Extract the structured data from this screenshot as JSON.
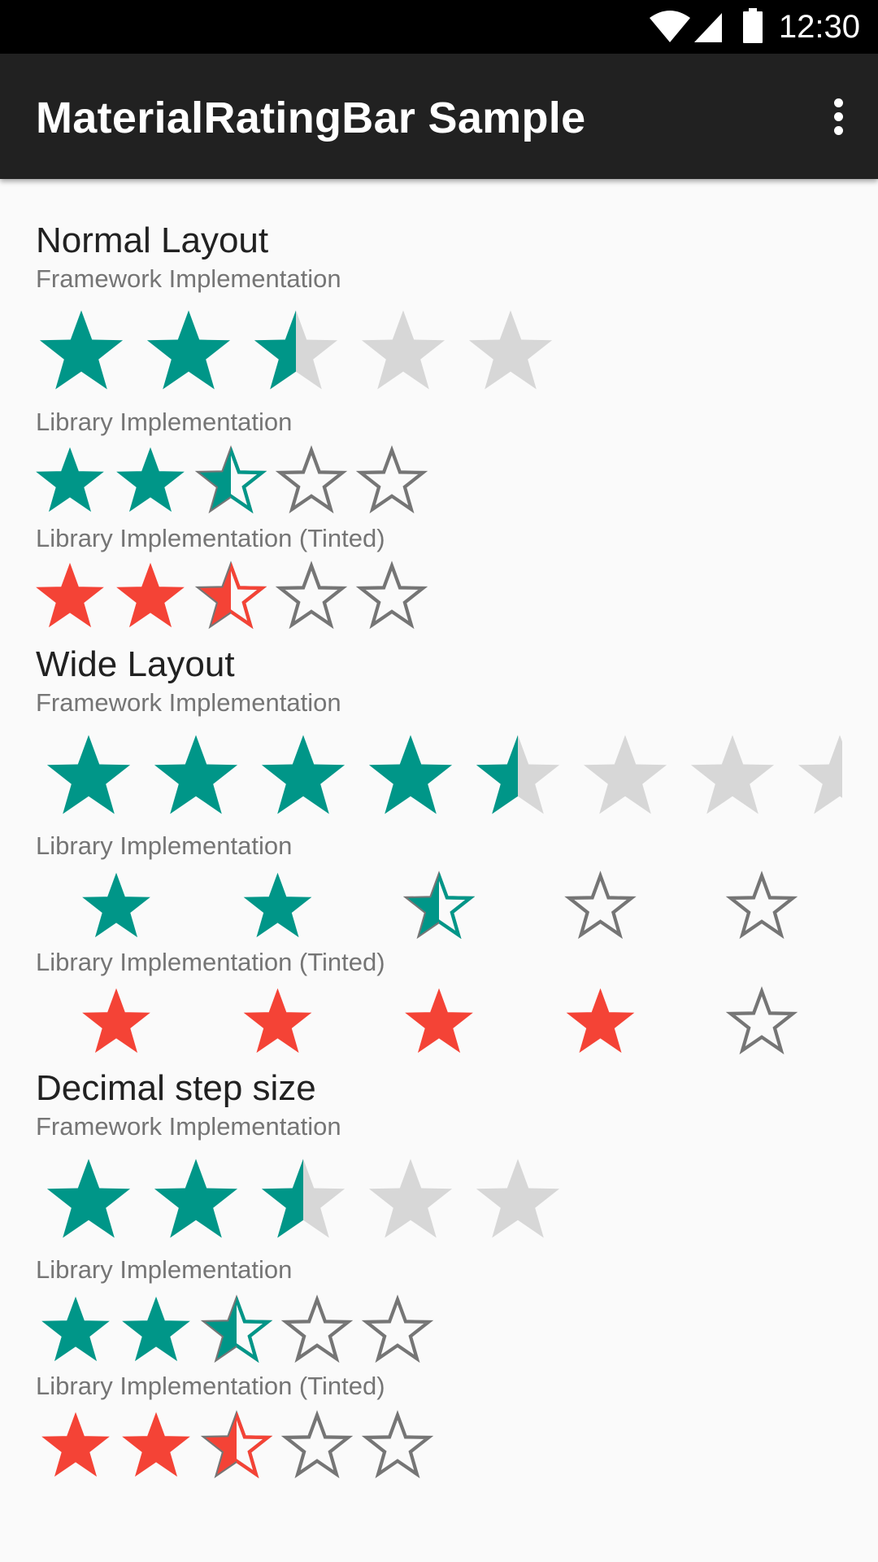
{
  "status_bar": {
    "time": "12:30",
    "icons": [
      "wifi-icon",
      "cellular-signal-icon",
      "battery-icon"
    ]
  },
  "app_bar": {
    "title": "MaterialRatingBar Sample",
    "overflow_icon": "more-vert-icon"
  },
  "colors": {
    "accent": "#009688",
    "tint": "#f44336",
    "framework_empty": "#d7d7d7",
    "library_outline": "#757575",
    "app_bar": "#212121",
    "background": "#fafafa"
  },
  "sections": [
    {
      "title": "Normal Layout",
      "bars": [
        {
          "caption": "Framework Implementation",
          "style": "framework",
          "color": "#009688",
          "num_stars": 5,
          "rating": 2.5
        },
        {
          "caption": "Library Implementation",
          "style": "library",
          "color": "#009688",
          "num_stars": 5,
          "rating": 2.5
        },
        {
          "caption": "Library Implementation (Tinted)",
          "style": "library",
          "color": "#f44336",
          "num_stars": 5,
          "rating": 2.5
        }
      ]
    },
    {
      "title": "Wide Layout",
      "bars": [
        {
          "caption": "Framework Implementation",
          "style": "framework",
          "color": "#009688",
          "num_stars": 8,
          "rating": 4.5
        },
        {
          "caption": "Library Implementation",
          "style": "library",
          "color": "#009688",
          "num_stars": 5,
          "rating": 2.5
        },
        {
          "caption": "Library Implementation (Tinted)",
          "style": "library",
          "color": "#f44336",
          "num_stars": 5,
          "rating": 4
        }
      ]
    },
    {
      "title": "Decimal step size",
      "bars": [
        {
          "caption": "Framework Implementation",
          "style": "framework",
          "color": "#009688",
          "num_stars": 5,
          "rating": 2.5
        },
        {
          "caption": "Library Implementation",
          "style": "library",
          "color": "#009688",
          "num_stars": 5,
          "rating": 2.5
        },
        {
          "caption": "Library Implementation (Tinted)",
          "style": "library",
          "color": "#f44336",
          "num_stars": 5,
          "rating": 2.5
        }
      ]
    }
  ]
}
